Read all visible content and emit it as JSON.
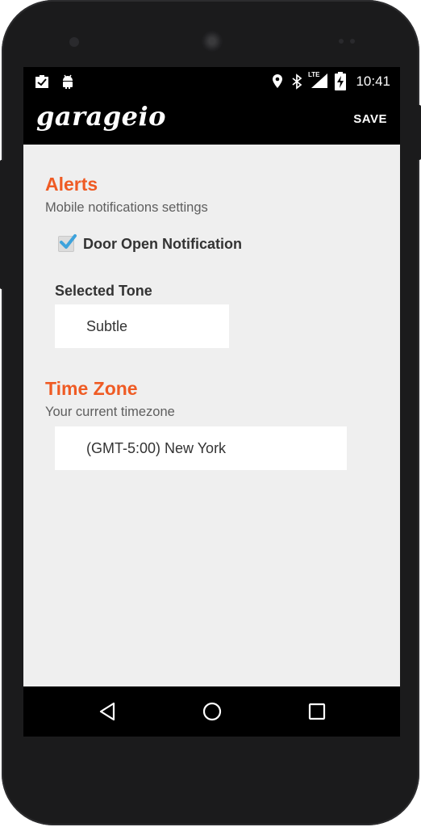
{
  "status_bar": {
    "time": "10:41",
    "left_icons": [
      "clipboard-check-icon",
      "android-icon"
    ],
    "right_icons": [
      "location-icon",
      "bluetooth-icon",
      "lte-signal-icon",
      "battery-charging-icon"
    ],
    "network_label": "LTE"
  },
  "app_bar": {
    "title": "garageio",
    "save_label": "SAVE"
  },
  "alerts": {
    "title": "Alerts",
    "subtitle": "Mobile notifications settings",
    "door_open_label": "Door Open Notification",
    "door_open_checked": true,
    "selected_tone_label": "Selected Tone",
    "selected_tone_value": "Subtle"
  },
  "time_zone": {
    "title": "Time Zone",
    "subtitle": "Your current timezone",
    "value": "(GMT-5:00) New York"
  },
  "nav_bar": {
    "icons": [
      "back-icon",
      "home-icon",
      "recents-icon"
    ]
  },
  "colors": {
    "accent": "#ef5b24",
    "checkmark": "#3ea3dc",
    "background": "#efefef",
    "bars": "#000000"
  }
}
